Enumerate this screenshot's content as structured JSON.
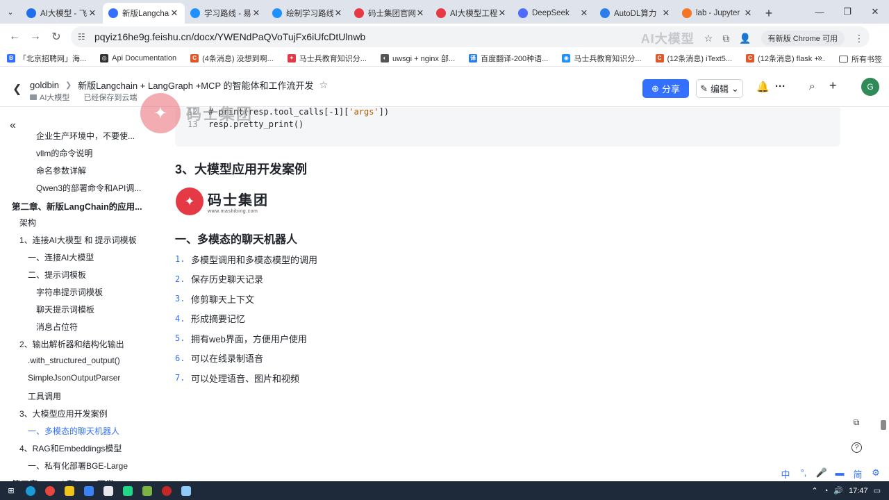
{
  "browser": {
    "tabs": [
      {
        "label": "AI大模型 - 飞书",
        "icon_color": "#1f6feb",
        "active": false
      },
      {
        "label": "新版Langchain",
        "icon_color": "#3370ff",
        "active": true
      },
      {
        "label": "学习路线 - 易",
        "icon_color": "#1e90ff",
        "active": false
      },
      {
        "label": "绘制学习路线",
        "icon_color": "#1e90ff",
        "active": false
      },
      {
        "label": "码士集团官网",
        "icon_color": "#e63946",
        "active": false
      },
      {
        "label": "AI大模型工程",
        "icon_color": "#e63946",
        "active": false
      },
      {
        "label": "DeepSeek",
        "icon_color": "#4d6bfe",
        "active": false
      },
      {
        "label": "AutoDL算力",
        "icon_color": "#2b7de9",
        "active": false
      },
      {
        "label": "lab - Jupyter",
        "icon_color": "#f37626",
        "active": false
      }
    ],
    "url": "pqyiz16he9g.feishu.cn/docx/YWENdPaQVoTujFx6iUfcDtUlnwb",
    "watermark": "AI大模型",
    "profile_label": "有新版 Chrome 可用",
    "bookmarks": [
      {
        "label": "「北京招聘网」海...",
        "icon_color": "#3370ff",
        "glyph": "B"
      },
      {
        "label": "Api Documentation",
        "icon_color": "#333333",
        "glyph": "◎"
      },
      {
        "label": "(4条消息) 没想到啊...",
        "icon_color": "#e0582b",
        "glyph": "C"
      },
      {
        "label": "马士兵教育知识分...",
        "icon_color": "#e63946",
        "glyph": "✦"
      },
      {
        "label": "uwsgi + nginx 部...",
        "icon_color": "#555555",
        "glyph": "◐"
      },
      {
        "label": "百度翻译-200种语...",
        "icon_color": "#2b7de9",
        "glyph": "译"
      },
      {
        "label": "马士兵教育知识分...",
        "icon_color": "#1e90ff",
        "glyph": "◉"
      },
      {
        "label": "(12条消息) iText5...",
        "icon_color": "#e0582b",
        "glyph": "C"
      },
      {
        "label": "(12条消息) flask +...",
        "icon_color": "#e0582b",
        "glyph": "C"
      }
    ],
    "bookmarks_more": "»",
    "all_bookmarks": "所有书签"
  },
  "doc": {
    "breadcrumb_root": "goldbin",
    "title": "新版Langchain + LangGraph +MCP 的智能体和工作流开发",
    "folder": "AI大模型",
    "save_status": "已经保存到云端",
    "share_label": "分享",
    "edit_label": "编辑",
    "avatar_initial": "G"
  },
  "toc": [
    {
      "label": "企业生产环境中，不要使...",
      "level": 3,
      "active": false
    },
    {
      "label": "vllm的命令说明",
      "level": 3,
      "active": false
    },
    {
      "label": "命名参数详解",
      "level": 3,
      "active": false
    },
    {
      "label": "Qwen3的部署命令和API调...",
      "level": 3,
      "active": false
    },
    {
      "label": "第二章、新版LangChain的应用...",
      "level": 0,
      "active": false
    },
    {
      "label": "架构",
      "level": 1,
      "active": false
    },
    {
      "label": "1、连接AI大模型 和 提示词模板",
      "level": 1,
      "active": false
    },
    {
      "label": "一、连接AI大模型",
      "level": 2,
      "active": false
    },
    {
      "label": "二、提示词模板",
      "level": 2,
      "active": false
    },
    {
      "label": "字符串提示词模板",
      "level": 3,
      "active": false
    },
    {
      "label": "聊天提示词模板",
      "level": 3,
      "active": false
    },
    {
      "label": "消息占位符",
      "level": 3,
      "active": false
    },
    {
      "label": "2、输出解析器和结构化输出",
      "level": 1,
      "active": false
    },
    {
      "label": ".with_structured_output()",
      "level": 2,
      "active": false
    },
    {
      "label": "SimpleJsonOutputParser",
      "level": 2,
      "active": false
    },
    {
      "label": "工具调用",
      "level": 2,
      "active": false
    },
    {
      "label": "3、大模型应用开发案例",
      "level": 1,
      "active": false
    },
    {
      "label": "一、多模态的聊天机器人",
      "level": 2,
      "active": true
    },
    {
      "label": "4、RAG和Embeddings模型",
      "level": 1,
      "active": false
    },
    {
      "label": "一、私有化部署BGE-Large",
      "level": 2,
      "active": false
    },
    {
      "label": "第三章、Tool 和 MCP开发",
      "level": 0,
      "active": false
    }
  ],
  "code": {
    "line12_num": "12",
    "line12_a": "# print(resp.tool_calls[-1][",
    "line12_str": "'args'",
    "line12_b": "])",
    "line13_num": "13",
    "line13": "resp.pretty_print()"
  },
  "content": {
    "section_heading": "3、大模型应用开发案例",
    "logo_name": "码士集团",
    "logo_url": "www.mashibing.com",
    "sub_heading": "一、多模态的聊天机器人",
    "list_items": [
      {
        "num": "1.",
        "text": "多模型调用和多模态模型的调用"
      },
      {
        "num": "2.",
        "text": "保存历史聊天记录"
      },
      {
        "num": "3.",
        "text": "修剪聊天上下文"
      },
      {
        "num": "4.",
        "text": "形成摘要记忆"
      },
      {
        "num": "5.",
        "text": "拥有web界面，方便用户使用"
      },
      {
        "num": "6.",
        "text": "可以在线录制语音"
      },
      {
        "num": "7.",
        "text": "可以处理语音、图片和视频"
      }
    ],
    "overlay_logo_text": "码士集团"
  },
  "ime": [
    "中",
    "°,",
    "🎤",
    "▬",
    "简",
    "⚙"
  ],
  "taskbar": {
    "time": "17:47"
  }
}
